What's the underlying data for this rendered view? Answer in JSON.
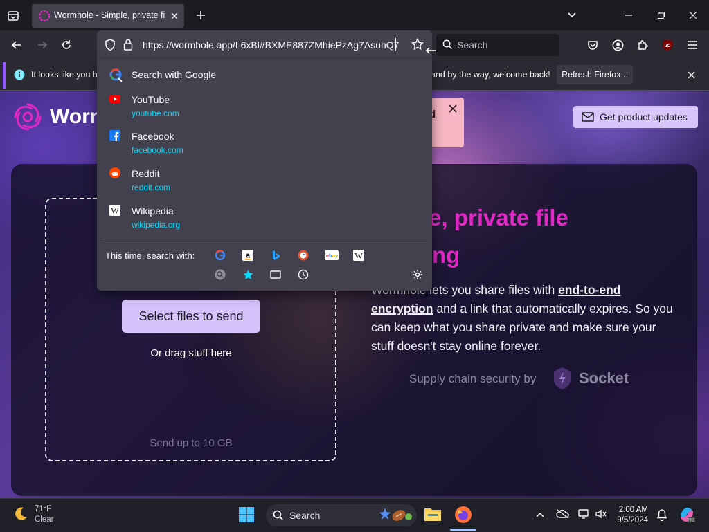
{
  "browser": {
    "tab": {
      "title": "Wormhole - Simple, private file sharing"
    },
    "url": "https://wormhole.app/L6xBl#BXME887ZMhiePzAg7AsuhQ7",
    "search_placeholder": "Search"
  },
  "notification": {
    "text_left": "It looks like you ha",
    "text_right": "and by the way, welcome back!",
    "button": "Refresh Firefox..."
  },
  "dropdown": {
    "search_with": "Search with Google",
    "suggestions": [
      {
        "title": "YouTube",
        "url": "youtube.com"
      },
      {
        "title": "Facebook",
        "url": "facebook.com"
      },
      {
        "title": "Reddit",
        "url": "reddit.com"
      },
      {
        "title": "Wikipedia",
        "url": "wikipedia.org"
      }
    ],
    "one_time_label": "This time, search with:"
  },
  "page": {
    "logo_text": "Worm",
    "toast_fragment": "d",
    "updates_button": "Get product updates",
    "select_button": "Select files to send",
    "drag_text": "Or drag stuff here",
    "limit_text": "Send up to 10 GB",
    "headline_line1": "le, private file",
    "headline_line2": "ng",
    "desc_part1": "Wormhole lets you share files with ",
    "desc_bold1": "end-to-end",
    "desc_bold2": "encryption",
    "desc_part2": " and a link that automatically expires. So you can keep what you share private and make sure your stuff doesn't stay online forever.",
    "supply_text": "Supply chain security by",
    "socket_text": "Socket"
  },
  "taskbar": {
    "temperature": "71°F",
    "condition": "Clear",
    "search_placeholder": "Search",
    "time": "2:00 AM",
    "date": "9/5/2024"
  },
  "colors": {
    "accent_purple": "#d6c2fb",
    "headline_pink": "#e127c4",
    "url_link_cyan": "#00ddff"
  },
  "icons": [
    "tab-list-icon",
    "wormhole-favicon",
    "close-icon",
    "new-tab-icon",
    "chevron-down-icon",
    "minimize-icon",
    "maximize-icon",
    "back-icon",
    "forward-icon",
    "reload-icon",
    "shield-icon",
    "lock-icon",
    "star-icon",
    "search-icon",
    "pocket-icon",
    "account-icon",
    "extensions-icon",
    "ublock-icon",
    "menu-icon",
    "info-icon",
    "google-icon",
    "youtube-icon",
    "facebook-icon",
    "reddit-icon",
    "wikipedia-icon",
    "amazon-icon",
    "bing-icon",
    "duckduckgo-icon",
    "ebay-icon",
    "tabs-search-icon",
    "bookmarks-search-icon",
    "history-search-icon",
    "settings-gear-icon",
    "mail-icon",
    "wormhole-logo-icon",
    "socket-logo-icon",
    "weather-moon-icon",
    "windows-start-icon",
    "file-explorer-icon",
    "firefox-icon",
    "copilot-icon",
    "chevron-up-icon",
    "onedrive-icon",
    "network-icon",
    "volume-icon",
    "notification-bell-icon"
  ]
}
